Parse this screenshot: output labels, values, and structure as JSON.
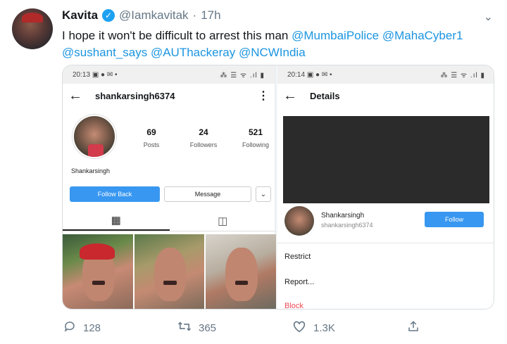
{
  "tweet": {
    "author_name": "Kavita",
    "handle": "@Iamkavitak",
    "separator": "·",
    "time": "17h",
    "text_parts": [
      {
        "text": "I hope it won't be difficult to arrest this man ",
        "type": "plain"
      },
      {
        "text": "@MumbaiPolice",
        "type": "mention"
      },
      {
        "text": " ",
        "type": "plain"
      },
      {
        "text": "@MahaCyber1",
        "type": "mention"
      },
      {
        "text": " ",
        "type": "plain"
      },
      {
        "text": "@sushant_says",
        "type": "mention"
      },
      {
        "text": " ",
        "type": "plain"
      },
      {
        "text": "@AUThackeray",
        "type": "mention"
      },
      {
        "text": " ",
        "type": "plain"
      },
      {
        "text": "@NCWIndia",
        "type": "mention"
      }
    ],
    "actions": {
      "reply_count": "128",
      "retweet_count": "365",
      "like_count": "1.3K"
    }
  },
  "left_phone": {
    "status_time": "20:13",
    "status_left_icons": "▣ ● ✉ •",
    "status_right_icons": "⁂ ☰ ᯤ .ıl ▮",
    "username": "shankarsingh6374",
    "stats": [
      {
        "value": "69",
        "label": "Posts"
      },
      {
        "value": "24",
        "label": "Followers"
      },
      {
        "value": "521",
        "label": "Following"
      }
    ],
    "display_name": "Shankarsingh",
    "follow_back_label": "Follow Back",
    "message_label": "Message",
    "more_label": "⌄"
  },
  "right_phone": {
    "status_time": "20:14",
    "status_left_icons": "▣ ● ✉ •",
    "status_right_icons": "⁂ ☰ ᯤ .ıl ▮",
    "title": "Details",
    "user_name": "Shankarsingh",
    "user_handle": "shankarsingh6374",
    "follow_label": "Follow",
    "menu": [
      "Restrict",
      "Report...",
      "Block"
    ]
  },
  "colors": {
    "twitter_blue": "#1da1f2",
    "mention": "#1b95e0",
    "instagram_blue": "#3897f0",
    "block_red": "#ed4956"
  },
  "icons": {
    "reply": "reply-icon",
    "retweet": "retweet-icon",
    "like": "heart-icon",
    "share": "share-icon",
    "verified": "verified-badge-icon",
    "caret": "chevron-down-icon"
  }
}
